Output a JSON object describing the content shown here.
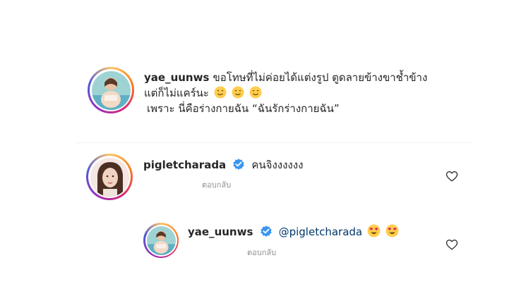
{
  "post": {
    "username": "yae_uunws",
    "caption_line1": "ขอโทษที่ไม่ค่อยได้แต่งรูป ตูดลายข้างขาช้ำข้าง",
    "caption_line2": "แต่ก็ไม่แคร์นะ",
    "caption_line3": "เพราะ นี่คือร่างกายฉัน “ฉันรักร่างกายฉัน”"
  },
  "comments": [
    {
      "username": "pigletcharada",
      "verified": true,
      "text": "คนจิงงงงงง",
      "reply_label": "ตอบกลับ"
    },
    {
      "username": "yae_uunws",
      "verified": true,
      "mention": "@pigletcharada",
      "reply_label": "ตอบกลับ"
    }
  ],
  "colors": {
    "verified_blue": "#3897f0",
    "mention_blue": "#00376b",
    "secondary_text": "#8e8e8e"
  }
}
